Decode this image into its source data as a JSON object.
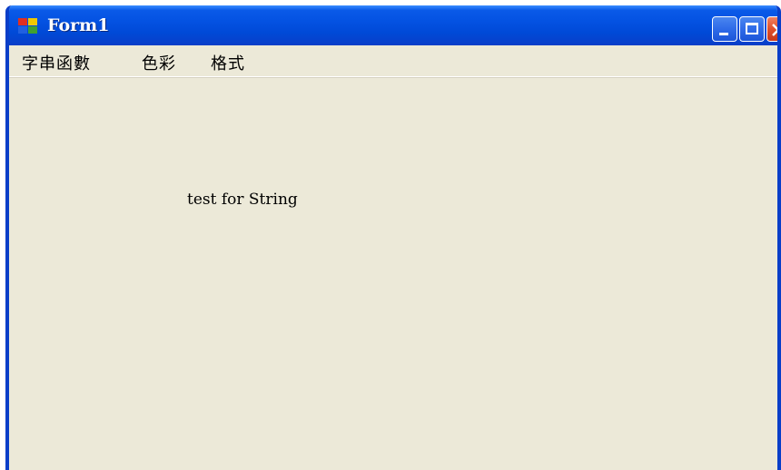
{
  "window": {
    "title": "Form1",
    "icon": "form-app-icon",
    "controls": {
      "minimize_icon": "minimize-icon",
      "maximize_icon": "maximize-icon",
      "close_icon": "close-icon"
    }
  },
  "menu": {
    "items": [
      {
        "label": "字串函數"
      },
      {
        "label": "色彩"
      },
      {
        "label": "格式"
      }
    ]
  },
  "client": {
    "label_text": "test for String"
  },
  "colors": {
    "titlebar": "#0452e2",
    "window_border": "#0a3ec8",
    "client_bg": "#ece9d8",
    "close_button": "#e0502a"
  }
}
